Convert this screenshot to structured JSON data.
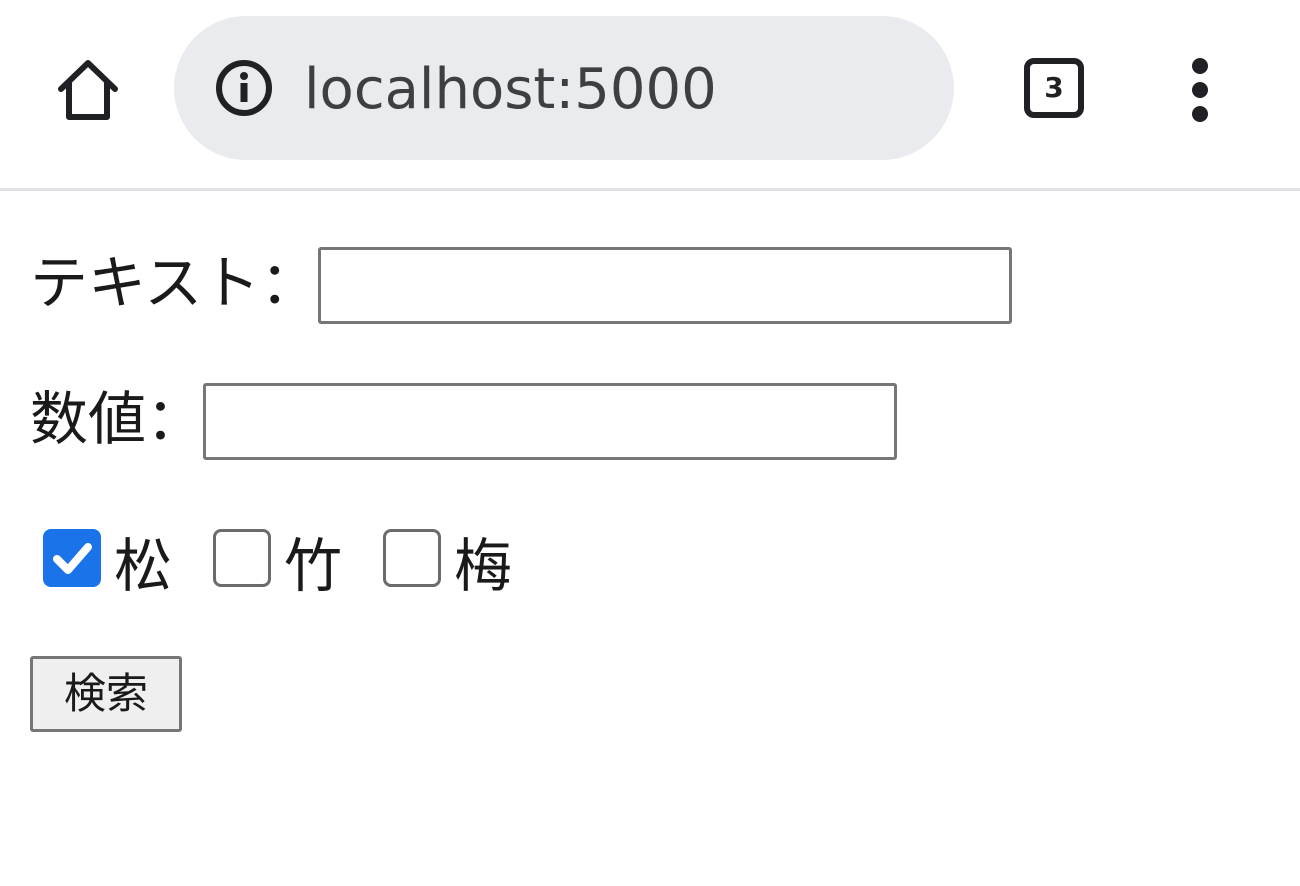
{
  "browser": {
    "home_icon": "home-icon",
    "info_icon": "info-icon",
    "url": "localhost:5000",
    "tab_count": "3",
    "menu_icon": "more-vert-icon"
  },
  "form": {
    "text_label": "テキスト：",
    "text_value": "",
    "number_label": "数値：",
    "number_value": "",
    "checkboxes": [
      {
        "label": "松",
        "checked": true
      },
      {
        "label": "竹",
        "checked": false
      },
      {
        "label": "梅",
        "checked": false
      }
    ],
    "submit_label": "検索"
  },
  "colors": {
    "checkbox_accent": "#1a73e8",
    "omnibox_bg": "#e9ebee"
  }
}
